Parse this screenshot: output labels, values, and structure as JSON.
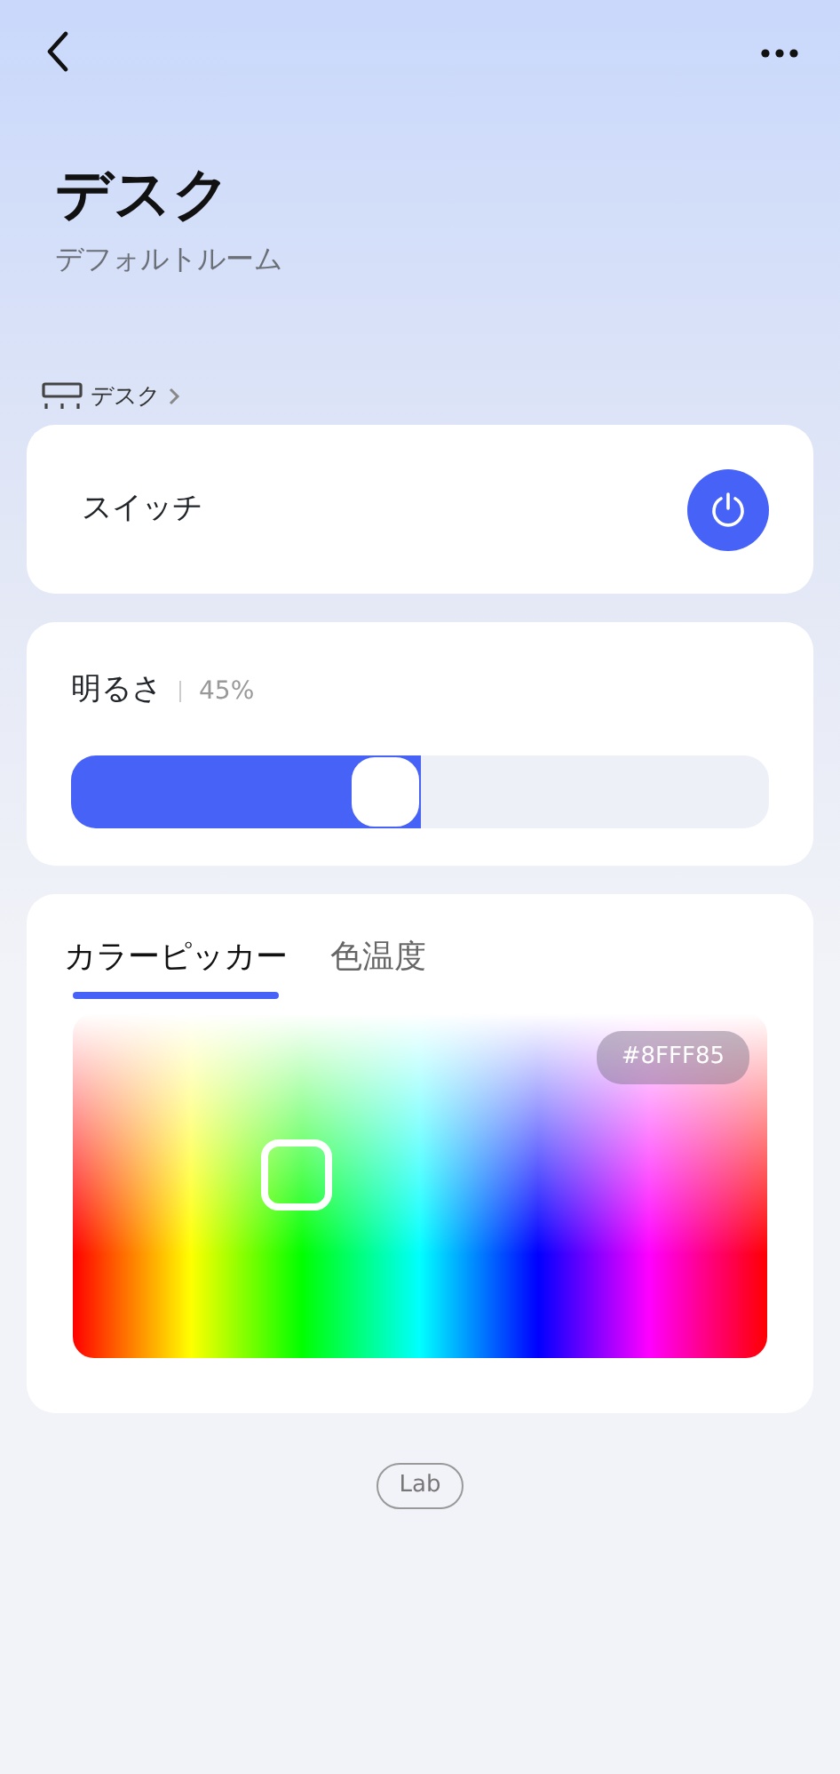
{
  "header": {
    "title": "デスク",
    "subtitle": "デフォルトルーム",
    "breadcrumb": "デスク"
  },
  "switch": {
    "label": "スイッチ",
    "on": true
  },
  "brightness": {
    "label": "明るさ",
    "reading": "45%",
    "level": 0.45
  },
  "color": {
    "tabs": [
      {
        "label": "カラーピッカー",
        "selected": true
      },
      {
        "label": "色温度",
        "selected": false
      }
    ],
    "hex": "#8FFF85"
  },
  "footer_badge": "Lab"
}
